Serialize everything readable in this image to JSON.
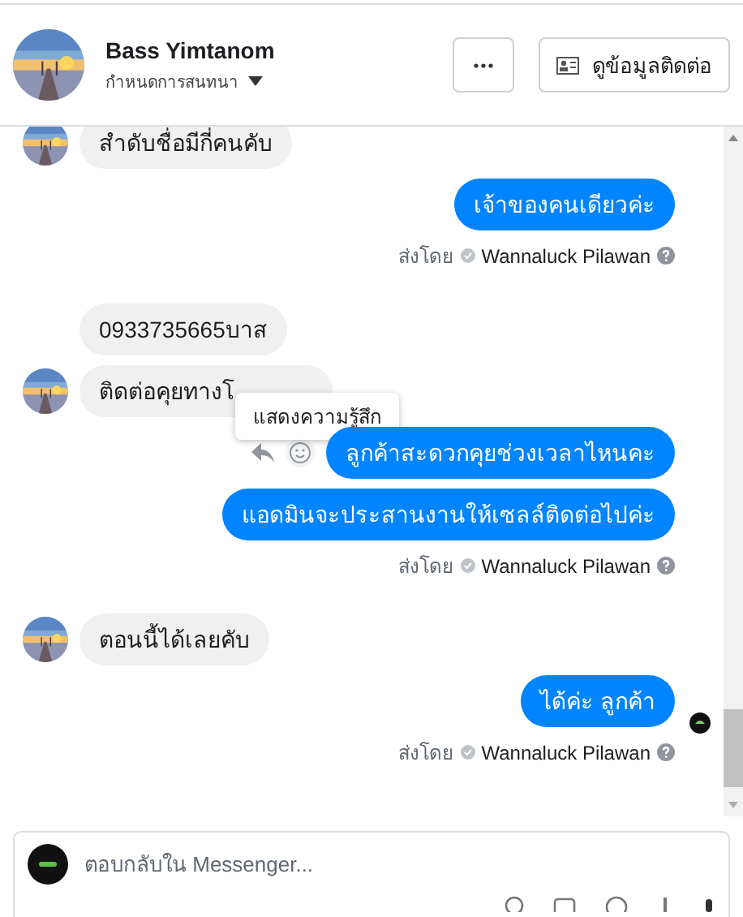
{
  "header": {
    "name": "Bass Yimtanom",
    "subtitle": "กำหนดการสนทนา",
    "contact_button": "ดูข้อมูลติดต่อ"
  },
  "messages": [
    {
      "kind": "received",
      "text": "สำดับชื่อมีกี่คนคับ",
      "avatar": true
    },
    {
      "kind": "sent",
      "text": "เจ้าของคนเดียวค่ะ"
    },
    {
      "kind": "sent_by",
      "prefix": "ส่งโดย",
      "name": "Wannaluck Pilawan"
    },
    {
      "kind": "received",
      "text": "0933735665บาส",
      "avatar": false
    },
    {
      "kind": "received",
      "text": "ติดต่อคุยทางโ",
      "avatar": true,
      "tooltip": "แสดงความรู้สึก"
    },
    {
      "kind": "sent",
      "text": "ลูกค้าสะดวกคุยช่วงเวลาไหนคะ",
      "actions": true
    },
    {
      "kind": "sent",
      "text": "แอดมินจะประสานงานให้เซลล์ติดต่อไปค่ะ"
    },
    {
      "kind": "sent_by",
      "prefix": "ส่งโดย",
      "name": "Wannaluck Pilawan"
    },
    {
      "kind": "received",
      "text": "ตอนนี้ได้เลยคับ",
      "avatar": true
    },
    {
      "kind": "sent",
      "text": "ได้ค่ะ ลูกค้า",
      "seen": true
    },
    {
      "kind": "sent_by",
      "prefix": "ส่งโดย",
      "name": "Wannaluck Pilawan"
    }
  ],
  "composer": {
    "placeholder": "ตอบกลับใน Messenger..."
  }
}
